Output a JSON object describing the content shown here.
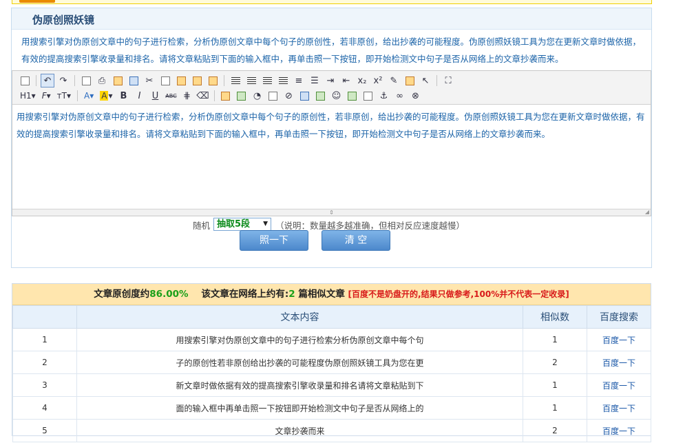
{
  "panel": {
    "title": "伪原创照妖镜",
    "intro": "用搜索引擎对伪原创文章中的句子进行检索，分析伪原创文章中每个句子的原创性，若非原创，给出抄袭的可能程度。伪原创照妖镜工具为您在更新文章时做依据，有效的提高搜索引擎收录量和排名。请将文章粘贴到下面的输入框中，再单击照一下按钮，即开始检测文中句子是否从网络上的文章抄袭而来。"
  },
  "editor": {
    "content": "用搜索引擎对伪原创文章中的句子进行检索，分析伪原创文章中每个句子的原创性，若非原创，给出抄袭的可能程度。伪原创照妖镜工具为您在更新文章时做依据，有效的提高搜索引擎收录量和排名。请将文章粘贴到下面的输入框中，再单击照一下按钮，即开始检测文中句子是否从网络上的文章抄袭而来。",
    "toolbar": {
      "heading": "H1",
      "font_family": "F",
      "font_size": "тT",
      "font_color": "A",
      "highlight": "A",
      "bold": "B",
      "italic": "I",
      "underline": "U",
      "strike": "ABC"
    }
  },
  "controls": {
    "random_label": "随机",
    "select_value": "抽取5段",
    "hint": "（说明：数量越多越准确，但相对反应速度越慢）",
    "check_button": "照一下",
    "clear_button": "清 空"
  },
  "results": {
    "summary_prefix": "文章原创度约",
    "originality": "86.00%",
    "summary_mid": "该文章在网络上约有:",
    "similar_count": "2",
    "summary_suffix": "篇相似文章",
    "warning": "[百度不是奶盘开的,结果只做参考,100%并不代表一定收录]",
    "columns": [
      "",
      "文本内容",
      "相似数",
      "百度搜索"
    ],
    "rows": [
      {
        "no": "1",
        "text": "用搜索引擎对伪原创文章中的句子进行检索分析伪原创文章中每个句",
        "count": "1",
        "action": "百度一下"
      },
      {
        "no": "2",
        "text": "子的原创性若非原创给出抄袭的可能程度伪原创照妖镜工具为您在更",
        "count": "2",
        "action": "百度一下"
      },
      {
        "no": "3",
        "text": "新文章时做依据有效的提高搜索引擎收录量和排名请将文章粘贴到下",
        "count": "1",
        "action": "百度一下"
      },
      {
        "no": "4",
        "text": "面的输入框中再单击照一下按钮即开始检测文中句子是否从网络上的",
        "count": "1",
        "action": "百度一下"
      },
      {
        "no": "5",
        "text": "文章抄袭而来",
        "count": "2",
        "action": "百度一下"
      }
    ]
  }
}
